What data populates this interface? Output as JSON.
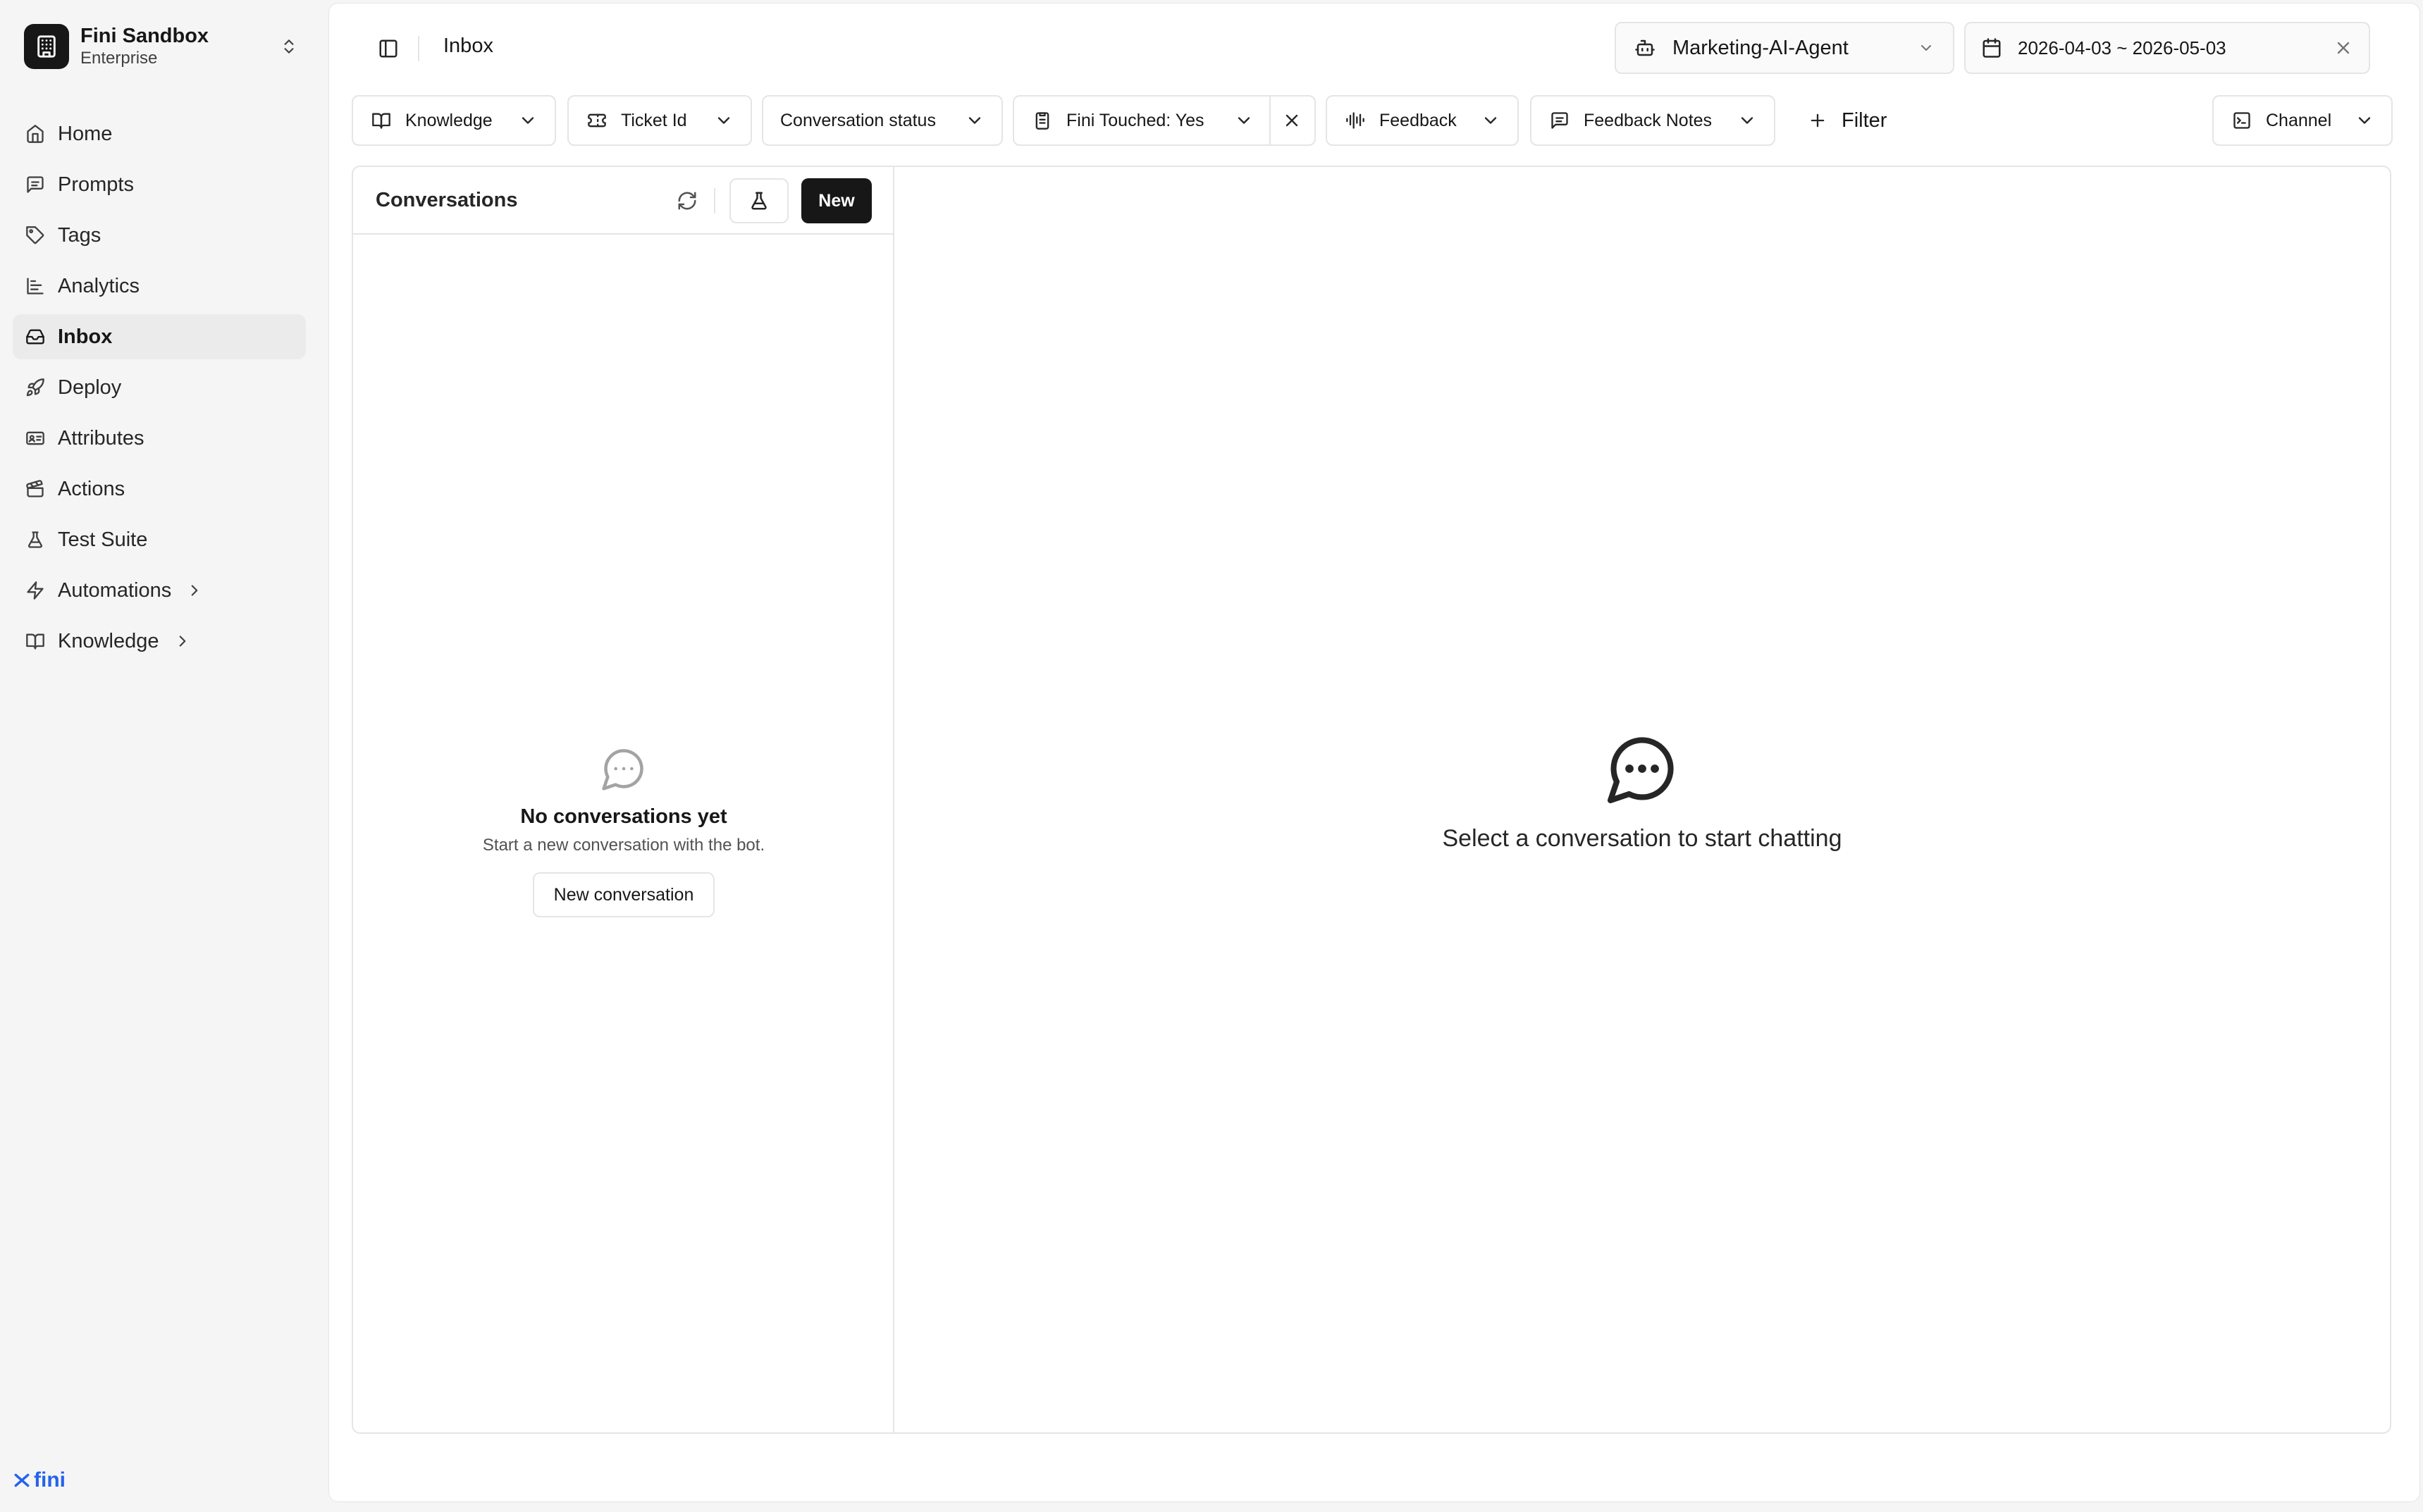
{
  "org": {
    "name": "Fini Sandbox",
    "plan": "Enterprise",
    "logo_icon": "building-icon"
  },
  "sidebar": {
    "items": [
      {
        "label": "Home",
        "icon": "home-icon"
      },
      {
        "label": "Prompts",
        "icon": "message-square-icon"
      },
      {
        "label": "Tags",
        "icon": "tag-icon"
      },
      {
        "label": "Analytics",
        "icon": "bar-chart-icon"
      },
      {
        "label": "Inbox",
        "icon": "inbox-icon",
        "active": true
      },
      {
        "label": "Deploy",
        "icon": "rocket-icon"
      },
      {
        "label": "Attributes",
        "icon": "id-card-icon"
      },
      {
        "label": "Actions",
        "icon": "clapperboard-icon"
      },
      {
        "label": "Test Suite",
        "icon": "flask-icon"
      },
      {
        "label": "Automations",
        "icon": "zap-icon",
        "expandable": true
      },
      {
        "label": "Knowledge",
        "icon": "book-open-icon",
        "expandable": true
      }
    ]
  },
  "brand": {
    "label": "fini",
    "color": "#2563eb"
  },
  "header": {
    "page_title": "Inbox",
    "agent": "Marketing-AI-Agent",
    "date_range": "2026-04-03 ~ 2026-05-03"
  },
  "filters": {
    "knowledge": "Knowledge",
    "ticket_id": "Ticket Id",
    "conversation_status": "Conversation status",
    "fini_touched": "Fini Touched: Yes",
    "feedback": "Feedback",
    "feedback_notes": "Feedback Notes",
    "add_filter": "Filter",
    "channel": "Channel"
  },
  "conversations": {
    "title": "Conversations",
    "new_label": "New",
    "empty_title": "No conversations yet",
    "empty_subtitle": "Start a new conversation with the bot.",
    "empty_button": "New conversation"
  },
  "chat": {
    "placeholder": "Select a conversation to start chatting"
  },
  "colors": {
    "primary": "#171717",
    "border": "#e5e5e5",
    "sidebar_bg": "#f5f5f5",
    "active_item": "#ebebeb"
  }
}
